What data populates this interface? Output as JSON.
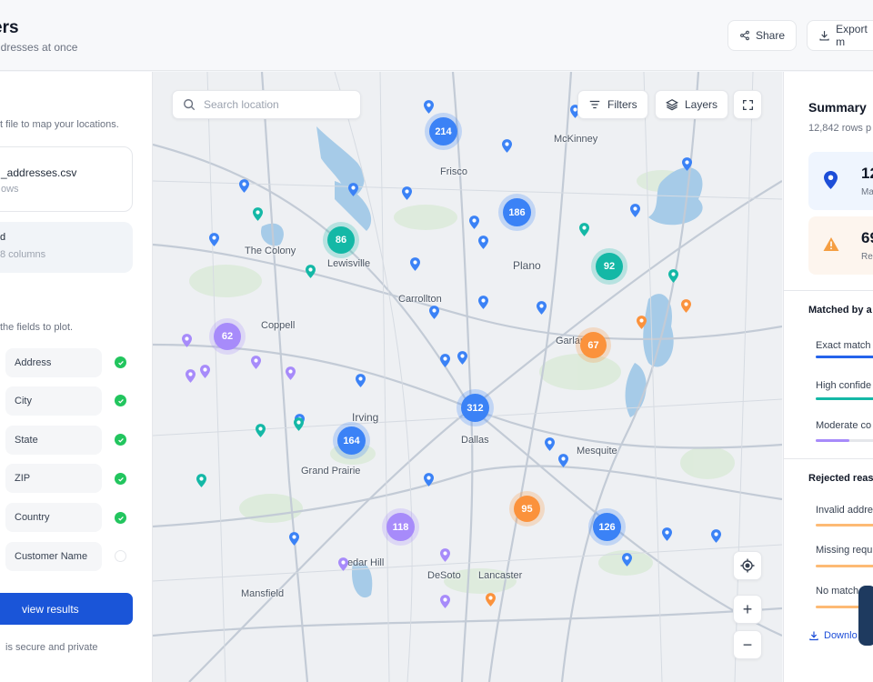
{
  "header": {
    "title": "ers",
    "subtitle": "ddresses at once",
    "share_label": "Share",
    "export_label": "Export m"
  },
  "left": {
    "upload_hint": "t file to map your locations.",
    "file_name": "_addresses.csv",
    "file_rows": "ows",
    "status_title": "d",
    "status_sub": "8 columns",
    "fields_hint": "the fields to plot.",
    "fields": [
      {
        "label": "Address",
        "checked": true
      },
      {
        "label": "City",
        "checked": true
      },
      {
        "label": "State",
        "checked": true
      },
      {
        "label": "ZIP",
        "checked": true
      },
      {
        "label": "Country",
        "checked": true
      },
      {
        "label": "Customer Name",
        "checked": false
      }
    ],
    "view_button": "view results",
    "secure_note": "is secure and private"
  },
  "map": {
    "search_placeholder": "Search location",
    "filters_label": "Filters",
    "layers_label": "Layers",
    "cities": [
      "McKinney",
      "Frisco",
      "Plano",
      "Carrollton",
      "Garland",
      "Irving",
      "Dallas",
      "Mesquite",
      "Mansfield",
      "DeSoto",
      "Lancaster",
      "Grand Prairie",
      "The Colony",
      "Lewisville",
      "Coppell",
      "Cedar Hill"
    ],
    "clusters": [
      {
        "value": "214",
        "color": "#3b82f6"
      },
      {
        "value": "186",
        "color": "#3b82f6"
      },
      {
        "value": "86",
        "color": "#14b8a6"
      },
      {
        "value": "92",
        "color": "#14b8a6"
      },
      {
        "value": "62",
        "color": "#a78bfa"
      },
      {
        "value": "67",
        "color": "#fb923c"
      },
      {
        "value": "312",
        "color": "#3b82f6"
      },
      {
        "value": "164",
        "color": "#3b82f6"
      },
      {
        "value": "95",
        "color": "#fb923c"
      },
      {
        "value": "118",
        "color": "#a78bfa"
      },
      {
        "value": "126",
        "color": "#3b82f6"
      }
    ]
  },
  "summary": {
    "title": "Summary",
    "subtitle": "12,842 rows p",
    "matched_value": "12",
    "matched_label": "Ma",
    "rejected_value": "69",
    "rejected_label": "Re",
    "matched_by_title": "Matched by a",
    "matched_rows": [
      {
        "label": "Exact match",
        "color": "#2563eb"
      },
      {
        "label": "High confide",
        "color": "#14b8a6"
      },
      {
        "label": "Moderate co",
        "color": "#a78bfa"
      }
    ],
    "rejected_title": "Rejected reas",
    "rejected_rows": [
      {
        "label": "Invalid addre",
        "color": "#fdba74"
      },
      {
        "label": "Missing requi",
        "color": "#fdba74"
      },
      {
        "label": "No match f",
        "color": "#fdba74"
      }
    ],
    "download_label": "Downlo"
  }
}
